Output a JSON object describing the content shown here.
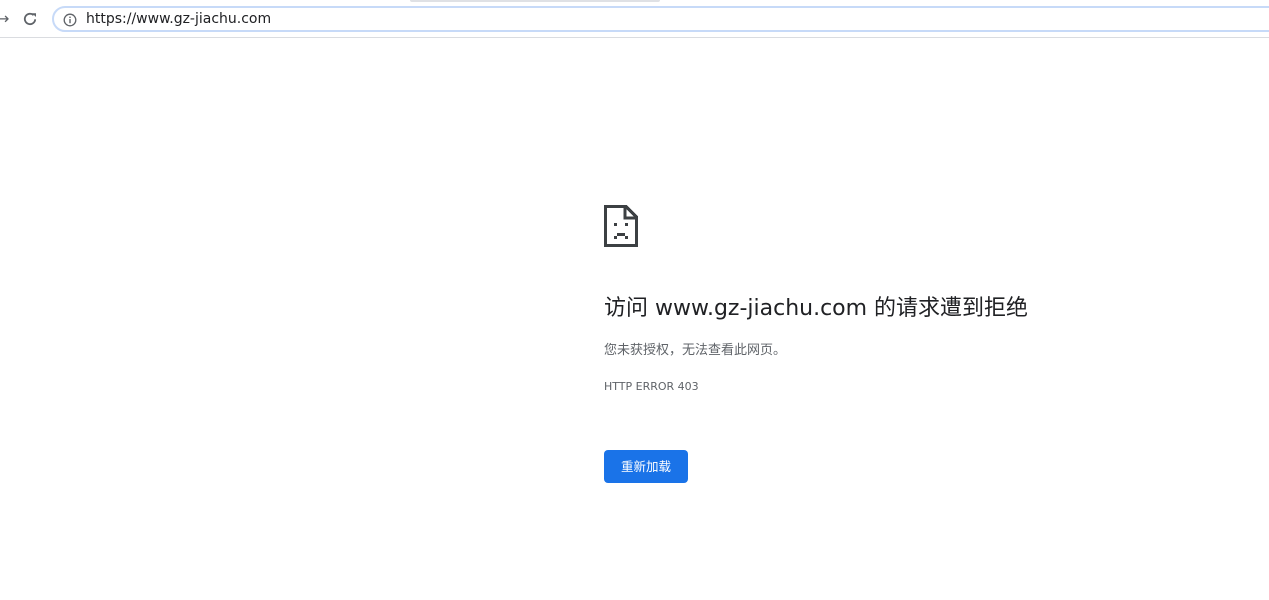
{
  "browser": {
    "url": "https://www.gz-jiachu.com",
    "forward_glyph": "→",
    "icons": {
      "forward": "arrow-forward-icon",
      "reload": "reload-icon",
      "info": "info-icon"
    }
  },
  "error": {
    "icon": "sad-page-icon",
    "heading": "访问 www.gz-jiachu.com 的请求遭到拒绝",
    "message": "您未获授权，无法查看此网页。",
    "code": "HTTP ERROR 403",
    "reload_label": "重新加载"
  },
  "colors": {
    "accent": "#1a73e8",
    "text_primary": "#202124",
    "text_secondary": "#5f6368",
    "omnibox_border": "#c7daf8"
  }
}
